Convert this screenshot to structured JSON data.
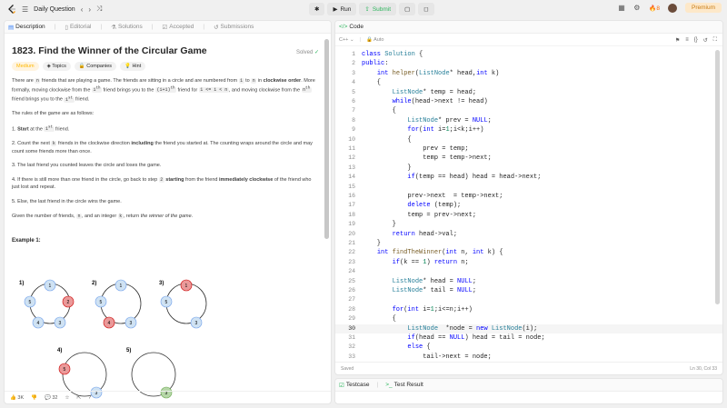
{
  "topbar": {
    "title": "Daily Question",
    "run_label": "Run",
    "submit_label": "Submit",
    "streak": "8",
    "premium_label": "Premium"
  },
  "left_tabs": [
    {
      "label": "Description"
    },
    {
      "label": "Editorial"
    },
    {
      "label": "Solutions"
    },
    {
      "label": "Accepted"
    },
    {
      "label": "Submissions"
    }
  ],
  "problem": {
    "title": "1823. Find the Winner of the Circular Game",
    "status": "Solved",
    "difficulty": "Medium",
    "topics_label": "Topics",
    "companies_label": "Companies",
    "hint_label": "Hint",
    "p1": {
      "a": "There are ",
      "n": "n",
      "b": " friends that are playing a game. The friends are sitting in a circle and are numbered from ",
      "one": "1",
      "to": " to ",
      "n2": "n",
      "c": " in ",
      "clockwise": "clockwise order",
      "d": ". More formally, moving clockwise from the ",
      "ith": "i",
      "e": " friend brings you to the ",
      "i1th": "(i+1)",
      "f": " friend for ",
      "range": "1 <= i < n",
      "g": ", and moving clockwise from the ",
      "nth": "n",
      "h": " friend brings you to the ",
      "first": "1",
      "i": " friend."
    },
    "rules_intro": "The rules of the game are as follows:",
    "rules": {
      "r1a": "1. ",
      "r1b": "Start",
      "r1c": " at the ",
      "r1d": "1",
      "r1e": " friend.",
      "r2a": "2. Count the next ",
      "r2b": "k",
      "r2c": " friends in the clockwise direction ",
      "r2d": "including",
      "r2e": " the friend you started at. The counting wraps around the circle and may count some friends more than once.",
      "r3": "3. The last friend you counted leaves the circle and loses the game.",
      "r4a": "4. If there is still more than one friend in the circle, go back to step ",
      "r4b": "2",
      "r4c": " starting",
      "r4d": " from the friend ",
      "r4e": "immediately clockwise",
      "r4f": " of the friend who just lost and repeat.",
      "r5": "5. Else, the last friend in the circle wins the game."
    },
    "p_last": {
      "a": "Given the number of friends, ",
      "n": "n",
      "b": ", and an integer ",
      "k": "k",
      "c": ", return ",
      "d": "the winner of the game",
      "e": "."
    },
    "example_label": "Example 1:",
    "likes": "3K",
    "comments": "32"
  },
  "diagram": {
    "labels": [
      "1)",
      "2)",
      "3)",
      "4)",
      "5)"
    ],
    "nodes": [
      "1",
      "2",
      "3",
      "4",
      "5"
    ]
  },
  "code_panel": {
    "tab_label": "Code",
    "language": "C++",
    "mode": "Auto",
    "saved": "Saved",
    "cursor": "Ln 30, Col 33"
  },
  "code_lines": [
    "class Solution {",
    "public:",
    "    int helper(ListNode* head,int k)",
    "    {",
    "        ListNode* temp = head;",
    "        while(head->next != head)",
    "        {",
    "            ListNode* prev = NULL;",
    "            for(int i=1;i<k;i++)",
    "            {",
    "                prev = temp;",
    "                temp = temp->next;",
    "            }",
    "            if(temp == head) head = head->next;",
    "",
    "            prev->next  = temp->next;",
    "            delete (temp);",
    "            temp = prev->next;",
    "        }",
    "        return head->val;",
    "    }",
    "    int findTheWinner(int n, int k) {",
    "        if(k == 1) return n;",
    "",
    "        ListNode* head = NULL;",
    "        ListNode* tail = NULL;",
    "",
    "        for(int i=1;i<=n;i++)",
    "        {",
    "            ListNode  *node = new ListNode(i);",
    "            if(head == NULL) head = tail = node;",
    "            else {",
    "                tail->next = node;"
  ],
  "bottom": {
    "testcase_label": "Testcase",
    "testresult_label": "Test Result"
  }
}
